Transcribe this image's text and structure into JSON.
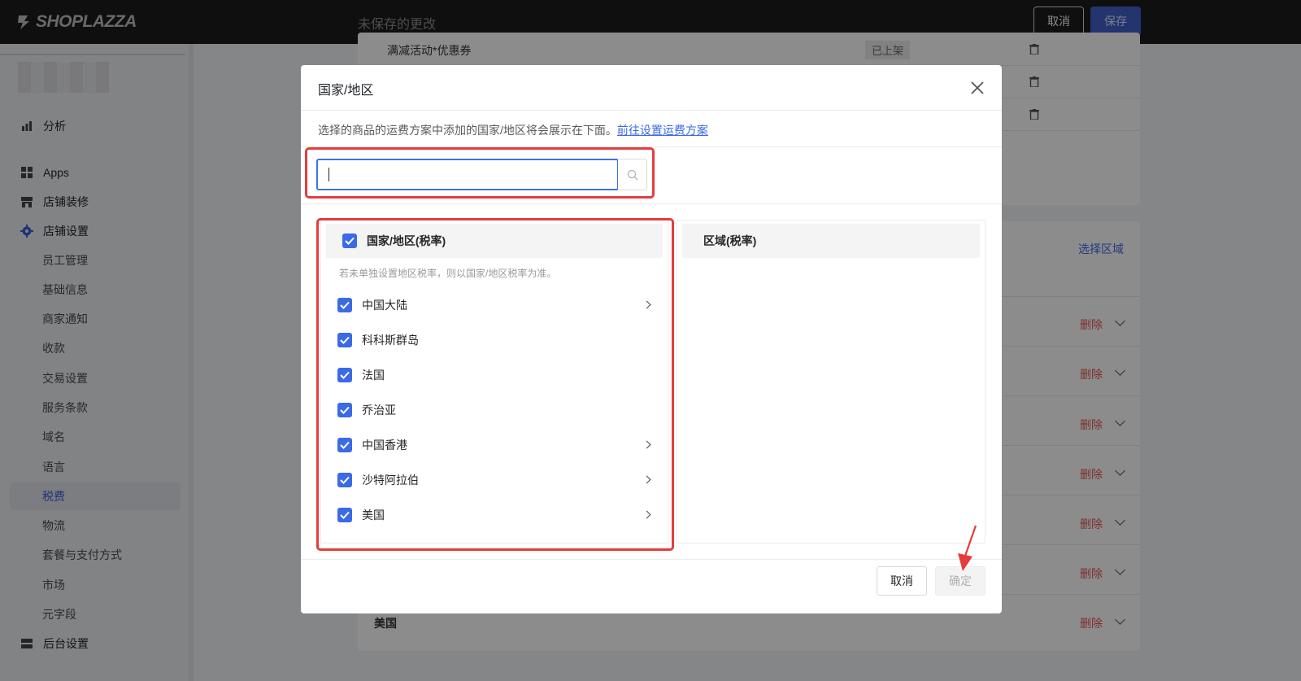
{
  "topbar": {
    "logo": "SHOPLAZZA",
    "unsaved": "未保存的更改",
    "cancel": "取消",
    "save": "保存"
  },
  "sidebar": {
    "items": [
      {
        "label": "分析",
        "icon": "bar-chart-icon"
      },
      {
        "label": "Apps",
        "icon": "apps-icon"
      },
      {
        "label": "店铺装修",
        "icon": "store-icon"
      },
      {
        "label": "店铺设置",
        "icon": "gear-icon"
      }
    ],
    "sub_items": [
      "员工管理",
      "基础信息",
      "商家通知",
      "收款",
      "交易设置",
      "服务条款",
      "域名",
      "语言",
      "税费",
      "物流",
      "套餐与支付方式",
      "市场",
      "元字段"
    ],
    "active_sub": "税费",
    "bottom_item": {
      "label": "后台设置",
      "icon": "server-icon"
    }
  },
  "background": {
    "top_row_text": "满减活动*优惠券",
    "top_row_badge": "已上架",
    "select_region": "选择区域",
    "delete_label": "删除",
    "last_country": "美国"
  },
  "modal": {
    "title": "国家/地区",
    "description": "选择的商品的运费方案中添加的国家/地区将会展示在下面。",
    "link": "前往设置运费方案",
    "search": {
      "value": "",
      "placeholder": ""
    },
    "left_header": "国家/地区(税率)",
    "hint": "若未单独设置地区税率，则以国家/地区税率为准。",
    "right_header": "区域(税率)",
    "countries": [
      {
        "name": "中国大陆",
        "checked": true,
        "has_children": true
      },
      {
        "name": "科科斯群岛",
        "checked": true,
        "has_children": false
      },
      {
        "name": "法国",
        "checked": true,
        "has_children": false
      },
      {
        "name": "乔治亚",
        "checked": true,
        "has_children": false
      },
      {
        "name": "中国香港",
        "checked": true,
        "has_children": true
      },
      {
        "name": "沙特阿拉伯",
        "checked": true,
        "has_children": true
      },
      {
        "name": "美国",
        "checked": true,
        "has_children": true
      }
    ],
    "cancel": "取消",
    "confirm": "确定"
  },
  "colors": {
    "accent": "#3b6ae6",
    "highlight": "#e63c3c",
    "save": "#4260c9"
  }
}
